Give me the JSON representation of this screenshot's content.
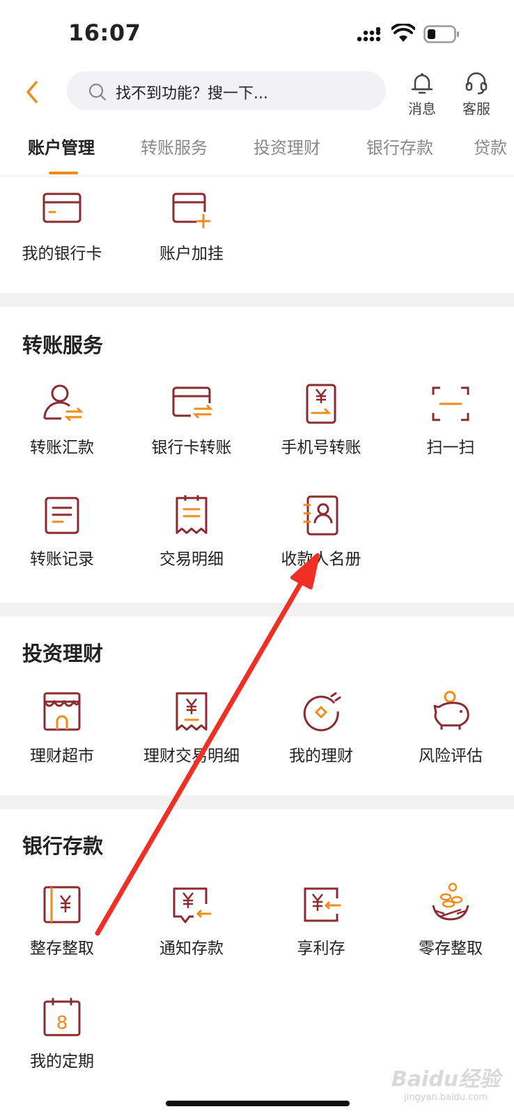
{
  "status_bar": {
    "time": "16:07"
  },
  "header": {
    "search_placeholder": "找不到功能？搜一下...",
    "messages_label": "消息",
    "service_label": "客服"
  },
  "tabs": [
    {
      "label": "账户管理",
      "active": true
    },
    {
      "label": "转账服务",
      "active": false
    },
    {
      "label": "投资理财",
      "active": false
    },
    {
      "label": "银行存款",
      "active": false
    },
    {
      "label": "贷款",
      "active": false
    }
  ],
  "account": {
    "items": [
      {
        "label": "我的银行卡",
        "icon": "bank-card-icon"
      },
      {
        "label": "账户加挂",
        "icon": "add-card-icon"
      }
    ]
  },
  "transfer": {
    "title": "转账服务",
    "items": [
      {
        "label": "转账汇款",
        "icon": "person-transfer-icon"
      },
      {
        "label": "银行卡转账",
        "icon": "card-transfer-icon"
      },
      {
        "label": "手机号转账",
        "icon": "phone-transfer-icon"
      },
      {
        "label": "扫一扫",
        "icon": "scan-icon"
      },
      {
        "label": "转账记录",
        "icon": "record-icon"
      },
      {
        "label": "交易明细",
        "icon": "receipt-icon"
      },
      {
        "label": "收款人名册",
        "icon": "contacts-book-icon"
      }
    ]
  },
  "invest": {
    "title": "投资理财",
    "items": [
      {
        "label": "理财超市",
        "icon": "store-icon"
      },
      {
        "label": "理财交易明细",
        "icon": "invest-receipt-icon"
      },
      {
        "label": "我的理财",
        "icon": "coin-ring-icon"
      },
      {
        "label": "风险评估",
        "icon": "piggy-bank-icon"
      }
    ]
  },
  "deposit": {
    "title": "银行存款",
    "items": [
      {
        "label": "整存整取",
        "icon": "deposit-book-icon"
      },
      {
        "label": "通知存款",
        "icon": "notice-deposit-icon"
      },
      {
        "label": "享利存",
        "icon": "interest-deposit-icon"
      },
      {
        "label": "零存整取",
        "icon": "coin-nest-icon"
      },
      {
        "label": "我的定期",
        "icon": "calendar-8-icon"
      }
    ]
  },
  "watermark": {
    "text": "Baidu经验",
    "url": "jingyan.baidu.com"
  },
  "colors": {
    "accent": "#f08c1a",
    "icon_dark": "#8b2a2f",
    "annotation_arrow": "#f03025"
  }
}
